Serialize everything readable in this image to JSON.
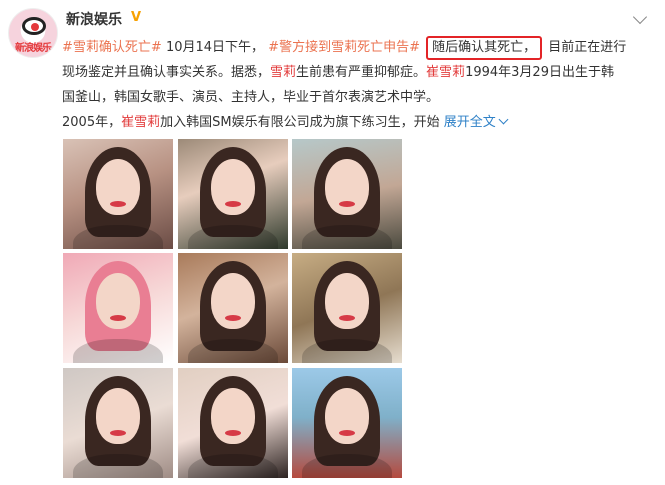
{
  "account": {
    "name": "新浪娱乐",
    "verified_badge": "V",
    "avatar_text": "新浪娱乐"
  },
  "post": {
    "topic1": "#雪莉确认死亡#",
    "time": "10月14日下午，",
    "topic2": "#警方接到雪莉死亡申告#",
    "boxed_text": "随后确认其死亡，",
    "seg_after_box": "目前正在进行",
    "line2_a": "现场鉴定并且确认事实关系。据悉，",
    "line2_name": "雪莉",
    "line2_b": "生前患有严重抑郁症。",
    "line2_name2": "崔雪莉",
    "line2_c": "1994年3月29日出生于韩",
    "line3": "国釜山，韩国女歌手、演员、主持人，毕业于首尔表演艺术中学。",
    "line4_a": "2005年，",
    "line4_name": "崔雪莉",
    "line4_b": "加入韩国SM娱乐有限公司成为旗下练习生，开始",
    "expand_label": "展开全文"
  },
  "colors": {
    "link": "#eb7350",
    "blue": "#2f81c7",
    "highlight_box": "#e32427",
    "verified": "#f7a102"
  },
  "icons": {
    "dropdown": "chevron-down-icon",
    "verified": "verified-badge-icon"
  }
}
